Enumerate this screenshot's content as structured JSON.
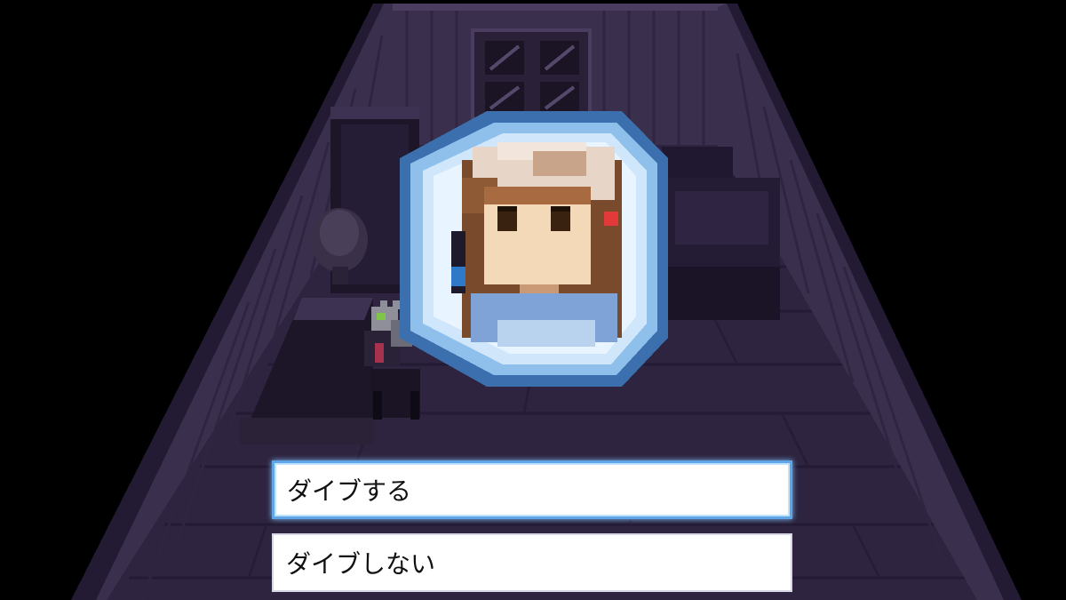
{
  "scene": {
    "background_color": "#000000",
    "room_color": "#2a2038",
    "wall_color": "#3a2f4d",
    "floor_color": "#2e2440"
  },
  "orb": {
    "icon": "character-portrait-orb-icon",
    "glow_color": "#7ec4ff"
  },
  "menu": {
    "selected_index": 0,
    "accent_color": "#5ea6e8",
    "choices": [
      {
        "label": "ダイブする"
      },
      {
        "label": "ダイブしない"
      }
    ]
  }
}
